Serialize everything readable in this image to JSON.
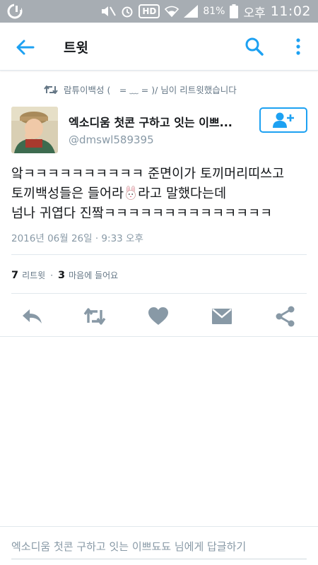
{
  "status_bar": {
    "battery_percent": "81%",
    "period": "오후",
    "time": "11:02",
    "hd_label": "HD"
  },
  "app_bar": {
    "title": "트윗"
  },
  "retweet_context": {
    "text": "람튜이백성 (　= ﹏ = )/ 님이 리트윗했습니다"
  },
  "author": {
    "display_name": "엑소디움 첫콘 구하고 잇는 이쁘...",
    "handle": "@dmswl589395"
  },
  "tweet": {
    "line1": "앜ㅋㅋㅋㅋㅋㅋㅋㅋㅋㅋ 준면이가 토끼머리띠쓰고",
    "line2_before": "토끼백성들은 들어라",
    "line2_after": "라고 말했다는데",
    "line3": "넘나 귀엽다 진짴ㅋㅋㅋㅋㅋㅋㅋㅋㅋㅋㅋㅋㅋㅋ",
    "timestamp": "2016년 06월 26일 · 9:33 오후"
  },
  "stats": {
    "retweet_count": "7",
    "retweet_label": "리트윗",
    "separator": "·",
    "like_count": "3",
    "like_label": "마음에 들어요"
  },
  "reply": {
    "placeholder": "엑소디움 첫콘 구하고 잇는 이쁘됴됴 님에게 답글하기"
  },
  "colors": {
    "accent": "#1da1f2",
    "icon_gray": "#8899a6",
    "status_bar": "#a7adb3"
  },
  "icons": [
    "back-arrow-icon",
    "search-icon",
    "more-vertical-icon",
    "retweet-icon",
    "add-user-icon",
    "reply-icon",
    "heart-icon",
    "message-icon",
    "share-icon"
  ]
}
